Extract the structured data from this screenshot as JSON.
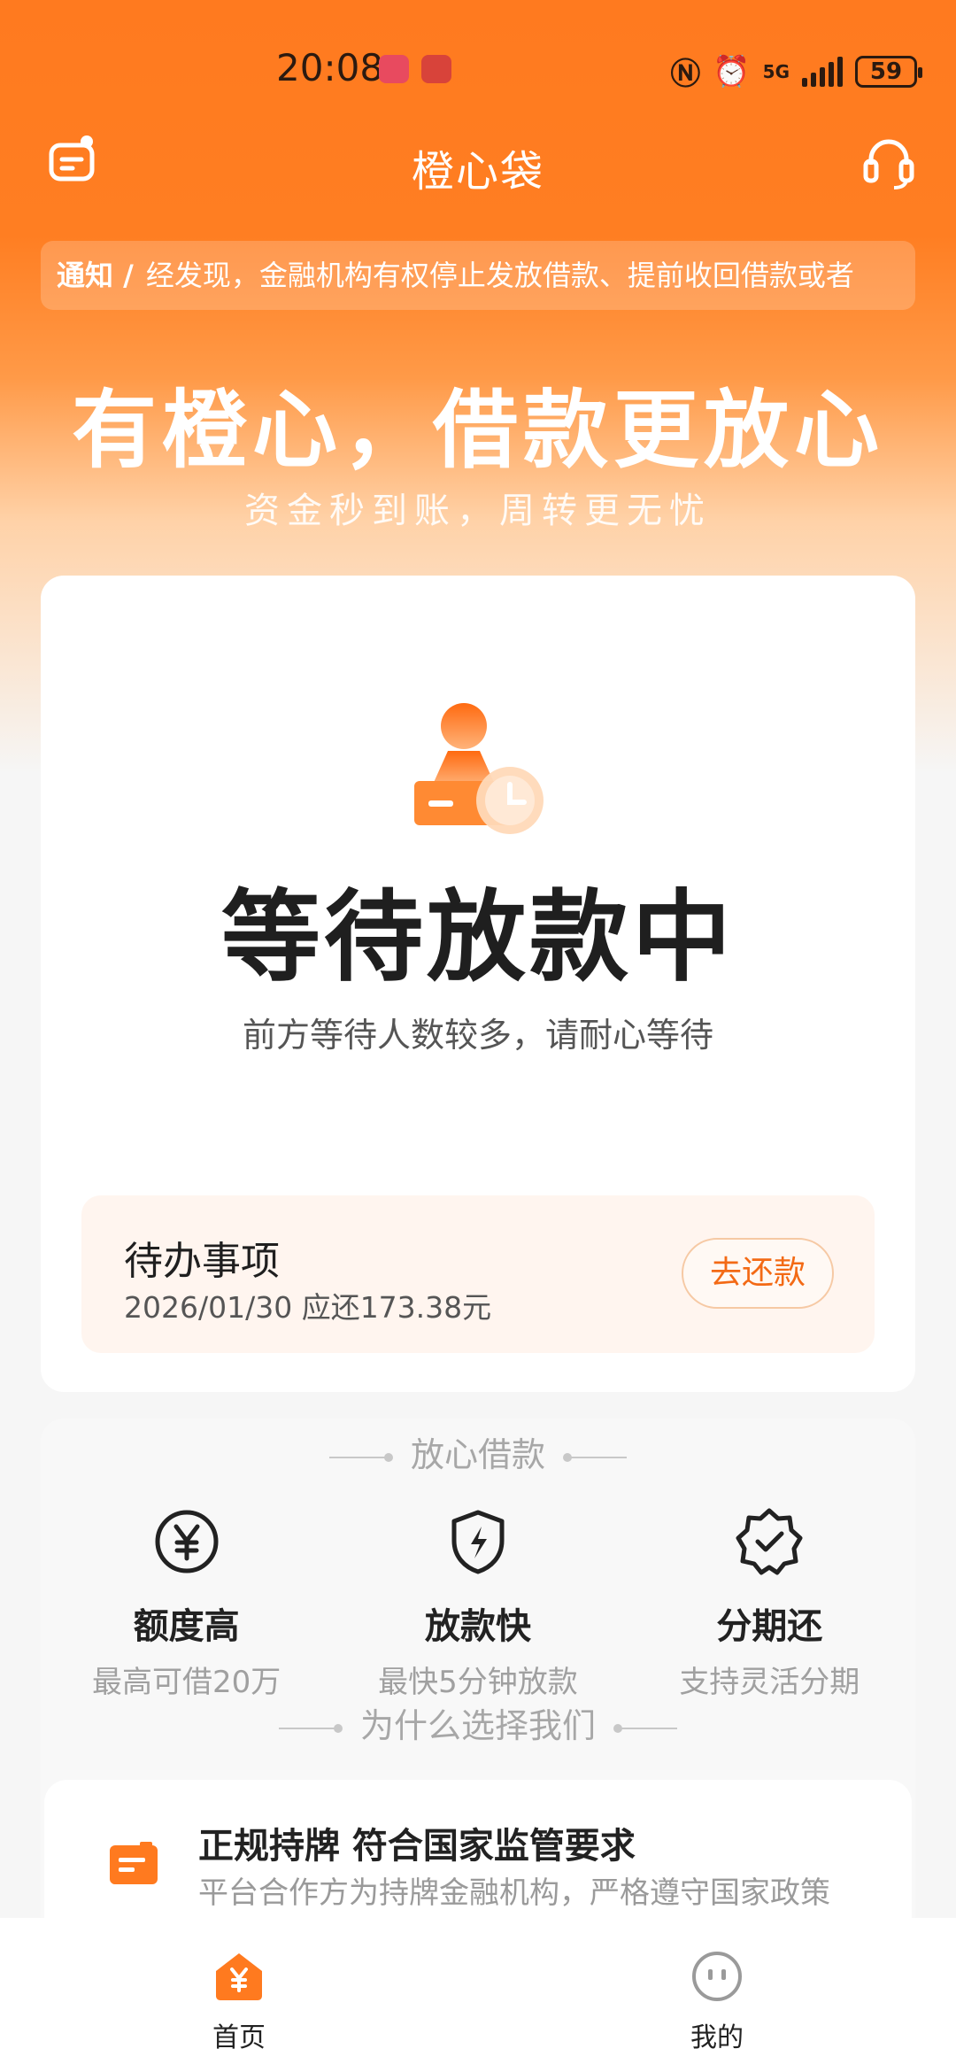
{
  "status_bar": {
    "time": "20:08",
    "network": "5G",
    "battery": "59",
    "app_icon_colors": [
      "#e84a5f",
      "#d8433a"
    ]
  },
  "header": {
    "title": "橙心袋"
  },
  "notice": {
    "tag": "通知 /",
    "text": "经发现，金融机构有权停止发放借款、提前收回借款或者"
  },
  "hero": {
    "slogan": "有橙心，借款更放心",
    "subslogan": "资金秒到账，周转更无忧"
  },
  "status_card": {
    "title": "等待放款中",
    "description": "前方等待人数较多，请耐心等待",
    "todo": {
      "title": "待办事项",
      "detail": "2026/01/30 应还173.38元",
      "button_label": "去还款"
    }
  },
  "features": {
    "heading": "放心借款",
    "items": [
      {
        "icon": "yuan-coin-icon",
        "title": "额度高",
        "subtitle": "最高可借20万"
      },
      {
        "icon": "lightning-shield-icon",
        "title": "放款快",
        "subtitle": "最快5分钟放款"
      },
      {
        "icon": "verified-badge-icon",
        "title": "分期还",
        "subtitle": "支持灵活分期"
      }
    ],
    "why_heading": "为什么选择我们",
    "why_item": {
      "title": "正规持牌 符合国家监管要求",
      "subtitle": "平台合作方为持牌金融机构，严格遵守国家政策"
    }
  },
  "bottom_nav": {
    "items": [
      {
        "label": "首页",
        "active": true
      },
      {
        "label": "我的",
        "active": false
      }
    ]
  },
  "colors": {
    "brand": "#ff7a1f",
    "accent": "#f36a15"
  }
}
